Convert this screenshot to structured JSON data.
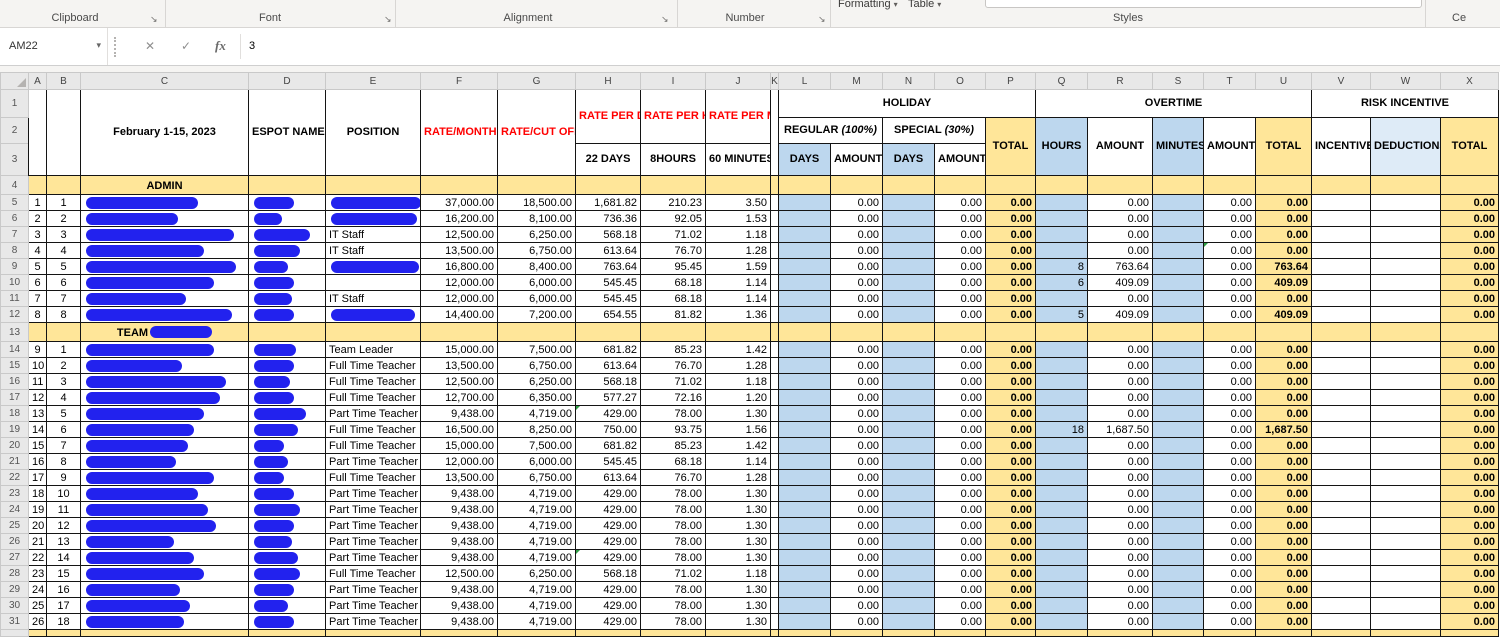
{
  "icons": {
    "dropdown": "▾",
    "cancel": "✕",
    "check": "✓",
    "launcher": "↘"
  },
  "ribbon": {
    "groups": [
      "Clipboard",
      "Font",
      "Alignment",
      "Number",
      "Styles"
    ],
    "partial_buttons": [
      "Formatting",
      "Table"
    ],
    "right_partial": "Ce"
  },
  "formula_bar": {
    "name_box": "AM22",
    "fx_label": "fx",
    "value": "3"
  },
  "grid": {
    "columns": [
      "A",
      "B",
      "C",
      "D",
      "E",
      "F",
      "G",
      "H",
      "I",
      "J",
      "K",
      "L",
      "M",
      "N",
      "O",
      "P",
      "Q",
      "R",
      "S",
      "T",
      "U",
      "V",
      "W",
      "X"
    ]
  },
  "header": {
    "row_numbers": [
      "1",
      "2",
      "3"
    ],
    "period": "February 1-15, 2023",
    "espot": "ESPOT NAME",
    "position": "POSITION",
    "rate_month": "RATE/MONTH",
    "rate_cutoff": "RATE/CUT OFF PERIOD",
    "rate_day": "RATE PER DAY",
    "rate_day_sub": "22 DAYS",
    "rate_hour": "RATE PER HOUR",
    "rate_hour_sub": "8HOURS",
    "rate_minute": "RATE PER MINUTE",
    "rate_minute_sub": "60 MINUTES",
    "holiday": "HOLIDAY",
    "regular": "REGULAR",
    "regular_pct": "(100%)",
    "special": "SPECIAL",
    "special_pct": "(30%)",
    "days": "DAYS",
    "amount": "AMOUNT",
    "total": "TOTAL",
    "overtime": "OVERTIME",
    "hours": "HOURS",
    "minutes": "MINUTES",
    "risk_incentive": "RISK INCENTIVE",
    "incentive": "INCENTIVE",
    "deductions": "DEDUCTIONS"
  },
  "defaults": {
    "l": "",
    "m": "0.00",
    "n": "",
    "o": "0.00",
    "p": "0.00",
    "q": "",
    "r": "0.00",
    "s": "",
    "t": "0.00",
    "u": "0.00",
    "v": "",
    "w": "",
    "x": "0.00",
    "pos": "",
    "pw": 0
  },
  "rows": [
    {
      "rn": "4",
      "type": "section",
      "label": "ADMIN",
      "redact": 0
    },
    {
      "rn": "5",
      "a": "1",
      "b": "1",
      "nw": 112,
      "ew": 40,
      "pos": "",
      "pw": 90,
      "f": "37,000.00",
      "g": "18,500.00",
      "h": "1,681.82",
      "i": "210.23",
      "j": "3.50"
    },
    {
      "rn": "6",
      "a": "2",
      "b": "2",
      "nw": 92,
      "ew": 28,
      "pos": "",
      "pw": 86,
      "f": "16,200.00",
      "g": "8,100.00",
      "h": "736.36",
      "i": "92.05",
      "j": "1.53"
    },
    {
      "rn": "7",
      "a": "3",
      "b": "3",
      "nw": 148,
      "ew": 56,
      "pos": "IT Staff",
      "f": "12,500.00",
      "g": "6,250.00",
      "h": "568.18",
      "i": "71.02",
      "j": "1.18"
    },
    {
      "rn": "8",
      "a": "4",
      "b": "4",
      "nw": 118,
      "ew": 46,
      "pos": "IT Staff",
      "f": "13,500.00",
      "g": "6,750.00",
      "h": "613.64",
      "i": "76.70",
      "j": "1.28",
      "gc": "t"
    },
    {
      "rn": "9",
      "a": "5",
      "b": "5",
      "nw": 150,
      "ew": 34,
      "pos": "",
      "pw": 88,
      "f": "16,800.00",
      "g": "8,400.00",
      "h": "763.64",
      "i": "95.45",
      "j": "1.59",
      "q": "8",
      "r": "763.64",
      "u": "763.64"
    },
    {
      "rn": "10",
      "a": "6",
      "b": "6",
      "nw": 128,
      "ew": 40,
      "pos": "",
      "pw": 0,
      "f": "12,000.00",
      "g": "6,000.00",
      "h": "545.45",
      "i": "68.18",
      "j": "1.14",
      "q": "6",
      "r": "409.09",
      "u": "409.09"
    },
    {
      "rn": "11",
      "a": "7",
      "b": "7",
      "nw": 100,
      "ew": 38,
      "pos": "IT Staff",
      "f": "12,000.00",
      "g": "6,000.00",
      "h": "545.45",
      "i": "68.18",
      "j": "1.14"
    },
    {
      "rn": "12",
      "a": "8",
      "b": "8",
      "nw": 146,
      "ew": 40,
      "pos": "",
      "pw": 84,
      "f": "14,400.00",
      "g": "7,200.00",
      "h": "654.55",
      "i": "81.82",
      "j": "1.36",
      "q": "5",
      "r": "409.09",
      "u": "409.09"
    },
    {
      "rn": "13",
      "type": "section",
      "label": "TEAM",
      "redact": 62
    },
    {
      "rn": "14",
      "a": "9",
      "b": "1",
      "nw": 128,
      "ew": 42,
      "pos": "Team Leader",
      "f": "15,000.00",
      "g": "7,500.00",
      "h": "681.82",
      "i": "85.23",
      "j": "1.42"
    },
    {
      "rn": "15",
      "a": "10",
      "b": "2",
      "nw": 96,
      "ew": 40,
      "pos": "Full Time Teacher",
      "f": "13,500.00",
      "g": "6,750.00",
      "h": "613.64",
      "i": "76.70",
      "j": "1.28"
    },
    {
      "rn": "16",
      "a": "11",
      "b": "3",
      "nw": 140,
      "ew": 36,
      "pos": "Full Time Teacher",
      "f": "12,500.00",
      "g": "6,250.00",
      "h": "568.18",
      "i": "71.02",
      "j": "1.18"
    },
    {
      "rn": "17",
      "a": "12",
      "b": "4",
      "nw": 134,
      "ew": 40,
      "pos": "Full Time Teacher",
      "f": "12,700.00",
      "g": "6,350.00",
      "h": "577.27",
      "i": "72.16",
      "j": "1.20"
    },
    {
      "rn": "18",
      "a": "13",
      "b": "5",
      "nw": 118,
      "ew": 52,
      "pos": "Part Time Teacher",
      "f": "9,438.00",
      "g": "4,719.00",
      "h": "429.00",
      "i": "78.00",
      "j": "1.30",
      "gc": "h"
    },
    {
      "rn": "19",
      "a": "14",
      "b": "6",
      "nw": 108,
      "ew": 44,
      "pos": "Full Time Teacher",
      "f": "16,500.00",
      "g": "8,250.00",
      "h": "750.00",
      "i": "93.75",
      "j": "1.56",
      "q": "18",
      "r": "1,687.50",
      "u": "1,687.50"
    },
    {
      "rn": "20",
      "a": "15",
      "b": "7",
      "nw": 102,
      "ew": 30,
      "pos": "Full Time Teacher",
      "f": "15,000.00",
      "g": "7,500.00",
      "h": "681.82",
      "i": "85.23",
      "j": "1.42"
    },
    {
      "rn": "21",
      "a": "16",
      "b": "8",
      "nw": 90,
      "ew": 34,
      "pos": "Part Time Teacher",
      "f": "12,000.00",
      "g": "6,000.00",
      "h": "545.45",
      "i": "68.18",
      "j": "1.14"
    },
    {
      "rn": "22",
      "a": "17",
      "b": "9",
      "nw": 128,
      "ew": 30,
      "pos": "Full Time Teacher",
      "f": "13,500.00",
      "g": "6,750.00",
      "h": "613.64",
      "i": "76.70",
      "j": "1.28"
    },
    {
      "rn": "23",
      "a": "18",
      "b": "10",
      "nw": 112,
      "ew": 40,
      "pos": "Part Time Teacher",
      "f": "9,438.00",
      "g": "4,719.00",
      "h": "429.00",
      "i": "78.00",
      "j": "1.30"
    },
    {
      "rn": "24",
      "a": "19",
      "b": "11",
      "nw": 122,
      "ew": 46,
      "pos": "Part Time Teacher",
      "f": "9,438.00",
      "g": "4,719.00",
      "h": "429.00",
      "i": "78.00",
      "j": "1.30"
    },
    {
      "rn": "25",
      "a": "20",
      "b": "12",
      "nw": 130,
      "ew": 40,
      "pos": "Part Time Teacher",
      "f": "9,438.00",
      "g": "4,719.00",
      "h": "429.00",
      "i": "78.00",
      "j": "1.30"
    },
    {
      "rn": "26",
      "a": "21",
      "b": "13",
      "nw": 88,
      "ew": 38,
      "pos": "Part Time Teacher",
      "f": "9,438.00",
      "g": "4,719.00",
      "h": "429.00",
      "i": "78.00",
      "j": "1.30"
    },
    {
      "rn": "27",
      "a": "22",
      "b": "14",
      "nw": 108,
      "ew": 44,
      "pos": "Part Time Teacher",
      "f": "9,438.00",
      "g": "4,719.00",
      "h": "429.00",
      "i": "78.00",
      "j": "1.30",
      "gc": "h"
    },
    {
      "rn": "28",
      "a": "23",
      "b": "15",
      "nw": 118,
      "ew": 46,
      "pos": "Full Time Teacher",
      "f": "12,500.00",
      "g": "6,250.00",
      "h": "568.18",
      "i": "71.02",
      "j": "1.18"
    },
    {
      "rn": "29",
      "a": "24",
      "b": "16",
      "nw": 94,
      "ew": 40,
      "pos": "Part Time Teacher",
      "f": "9,438.00",
      "g": "4,719.00",
      "h": "429.00",
      "i": "78.00",
      "j": "1.30"
    },
    {
      "rn": "30",
      "a": "25",
      "b": "17",
      "nw": 104,
      "ew": 34,
      "pos": "Part Time Teacher",
      "f": "9,438.00",
      "g": "4,719.00",
      "h": "429.00",
      "i": "78.00",
      "j": "1.30"
    },
    {
      "rn": "31",
      "a": "26",
      "b": "18",
      "nw": 98,
      "ew": 40,
      "pos": "Part Time Teacher",
      "f": "9,438.00",
      "g": "4,719.00",
      "h": "429.00",
      "i": "78.00",
      "j": "1.30"
    },
    {
      "rn": "32",
      "type": "section",
      "label": "",
      "redact": 0,
      "partial": true
    }
  ]
}
